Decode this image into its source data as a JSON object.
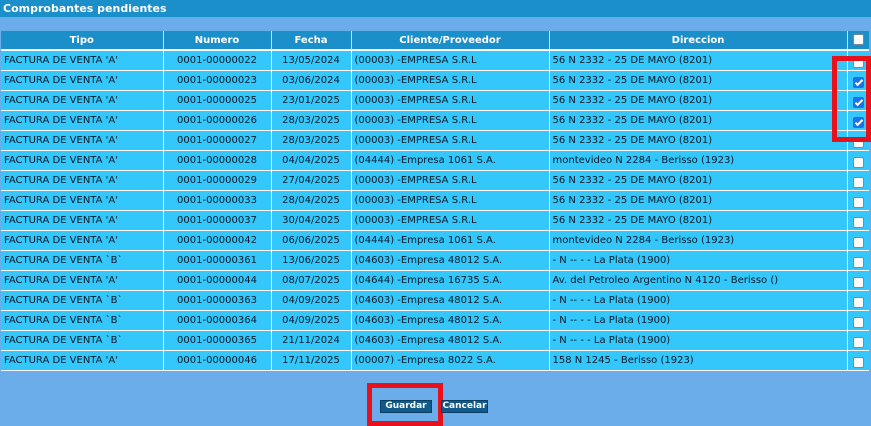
{
  "window": {
    "title": "Comprobantes pendientes"
  },
  "table": {
    "headers": [
      "Tipo",
      "Numero",
      "Fecha",
      "Cliente/Proveedor",
      "Direccion"
    ],
    "rows": [
      {
        "tipo": "FACTURA DE VENTA 'A'",
        "numero": "0001-00000022",
        "fecha": "13/05/2024",
        "cliente": "(00003) -EMPRESA S.R.L",
        "direccion": "56 N 2332 - 25 DE MAYO (8201)",
        "checked": false
      },
      {
        "tipo": "FACTURA DE VENTA 'A'",
        "numero": "0001-00000023",
        "fecha": "03/06/2024",
        "cliente": "(00003) -EMPRESA S.R.L",
        "direccion": "56 N 2332 - 25 DE MAYO (8201)",
        "checked": true
      },
      {
        "tipo": "FACTURA DE VENTA 'A'",
        "numero": "0001-00000025",
        "fecha": "23/01/2025",
        "cliente": "(00003) -EMPRESA S.R.L",
        "direccion": "56 N 2332 - 25 DE MAYO (8201)",
        "checked": true
      },
      {
        "tipo": "FACTURA DE VENTA 'A'",
        "numero": "0001-00000026",
        "fecha": "28/03/2025",
        "cliente": "(00003) -EMPRESA S.R.L",
        "direccion": "56 N 2332 - 25 DE MAYO (8201)",
        "checked": true
      },
      {
        "tipo": "FACTURA DE VENTA 'A'",
        "numero": "0001-00000027",
        "fecha": "28/03/2025",
        "cliente": "(00003) -EMPRESA S.R.L",
        "direccion": "56 N 2332 - 25 DE MAYO (8201)",
        "checked": false
      },
      {
        "tipo": "FACTURA DE VENTA 'A'",
        "numero": "0001-00000028",
        "fecha": "04/04/2025",
        "cliente": "(04444) -Empresa 1061 S.A.",
        "direccion": "montevideo N 2284 - Berisso (1923)",
        "checked": false
      },
      {
        "tipo": "FACTURA DE VENTA 'A'",
        "numero": "0001-00000029",
        "fecha": "27/04/2025",
        "cliente": "(00003) -EMPRESA S.R.L",
        "direccion": "56 N 2332 - 25 DE MAYO (8201)",
        "checked": false
      },
      {
        "tipo": "FACTURA DE VENTA 'A'",
        "numero": "0001-00000033",
        "fecha": "28/04/2025",
        "cliente": "(00003) -EMPRESA S.R.L",
        "direccion": "56 N 2332 - 25 DE MAYO (8201)",
        "checked": false
      },
      {
        "tipo": "FACTURA DE VENTA 'A'",
        "numero": "0001-00000037",
        "fecha": "30/04/2025",
        "cliente": "(00003) -EMPRESA S.R.L",
        "direccion": "56 N 2332 - 25 DE MAYO (8201)",
        "checked": false
      },
      {
        "tipo": "FACTURA DE VENTA 'A'",
        "numero": "0001-00000042",
        "fecha": "06/06/2025",
        "cliente": "(04444) -Empresa 1061 S.A.",
        "direccion": "montevideo N 2284 - Berisso (1923)",
        "checked": false
      },
      {
        "tipo": "FACTURA DE VENTA `B`",
        "numero": "0001-00000361",
        "fecha": "13/06/2025",
        "cliente": "(04603) -Empresa 48012 S.A.",
        "direccion": "- N -- - - La Plata (1900)",
        "checked": false
      },
      {
        "tipo": "FACTURA DE VENTA 'A'",
        "numero": "0001-00000044",
        "fecha": "08/07/2025",
        "cliente": "(04644) -Empresa 16735 S.A.",
        "direccion": "Av. del Petroleo Argentino N 4120 - Berisso ()",
        "checked": false
      },
      {
        "tipo": "FACTURA DE VENTA `B`",
        "numero": "0001-00000363",
        "fecha": "04/09/2025",
        "cliente": "(04603) -Empresa 48012 S.A.",
        "direccion": "- N -- - - La Plata (1900)",
        "checked": false
      },
      {
        "tipo": "FACTURA DE VENTA `B`",
        "numero": "0001-00000364",
        "fecha": "04/09/2025",
        "cliente": "(04603) -Empresa 48012 S.A.",
        "direccion": "- N -- - - La Plata (1900)",
        "checked": false
      },
      {
        "tipo": "FACTURA DE VENTA `B`",
        "numero": "0001-00000365",
        "fecha": "21/11/2024",
        "cliente": "(04603) -Empresa 48012 S.A.",
        "direccion": "- N -- - - La Plata (1900)",
        "checked": false
      },
      {
        "tipo": "FACTURA DE VENTA 'A'",
        "numero": "0001-00000046",
        "fecha": "17/11/2025",
        "cliente": "(00007) -Empresa 8022 S.A.",
        "direccion": "158 N 1245 - Berisso (1923)",
        "checked": false
      }
    ]
  },
  "buttons": {
    "save": "Guardar",
    "cancel": "Cancelar"
  },
  "colors": {
    "header": "#1b8fc9",
    "row": "#33c7fb",
    "highlight": "#e8101a",
    "button": "#0f5a8a"
  }
}
